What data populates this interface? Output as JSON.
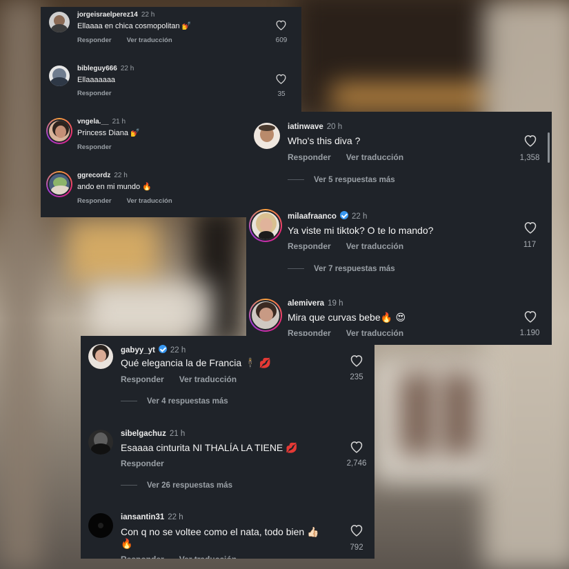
{
  "labels": {
    "reply": "Responder",
    "translate": "Ver traducción"
  },
  "panel1": {
    "comments": [
      {
        "username": "jorgeisraelperez14",
        "time": "22 h",
        "text": "Ellaaaa en chica cosmopolitan",
        "emoji": "💅",
        "likes": "609",
        "translate": true
      },
      {
        "username": "bibleguy666",
        "time": "22 h",
        "text": "Ellaaaaaaa",
        "emoji": "",
        "likes": "35",
        "translate": false
      },
      {
        "username": "vngela.__",
        "time": "21 h",
        "text": "Princess Diana",
        "emoji": "💅",
        "likes": "",
        "translate": false
      },
      {
        "username": "ggrecordz",
        "time": "22 h",
        "text": "ando en mi mundo",
        "emoji": "🔥",
        "likes": "",
        "translate": true
      }
    ]
  },
  "panel2": {
    "comments": [
      {
        "username": "iatinwave",
        "time": "20 h",
        "text": "Who's this diva ?",
        "likes": "1,358",
        "more": "Ver 5 respuestas más"
      },
      {
        "username": "milaafraanco",
        "verified": true,
        "time": "22 h",
        "text": "Ya viste mi tiktok? O te lo mando?",
        "likes": "117",
        "more": "Ver 7 respuestas más"
      },
      {
        "username": "alemivera",
        "time": "19 h",
        "text": "Mira que curvas bebe",
        "emoji": "🔥 😍",
        "likes": "1.190"
      }
    ]
  },
  "panel3": {
    "comments": [
      {
        "username": "gabyy_yt",
        "verified": true,
        "time": "22 h",
        "text": "Qué elegancia la de Francia",
        "emoji": "🕴 💋",
        "likes": "235",
        "more": "Ver 4 respuestas más"
      },
      {
        "username": "sibelgachuz",
        "time": "21 h",
        "text": "Esaaaa cinturita NI THALÍA LA TIENE",
        "emoji": "💋",
        "likes": "2,746",
        "more": "Ver 26 respuestas más"
      },
      {
        "username": "iansantin31",
        "time": "22 h",
        "text": "Con q no se voltee como el nata, todo bien",
        "emoji": "👍🏻",
        "emoji2": "🔥",
        "likes": "792"
      }
    ]
  }
}
